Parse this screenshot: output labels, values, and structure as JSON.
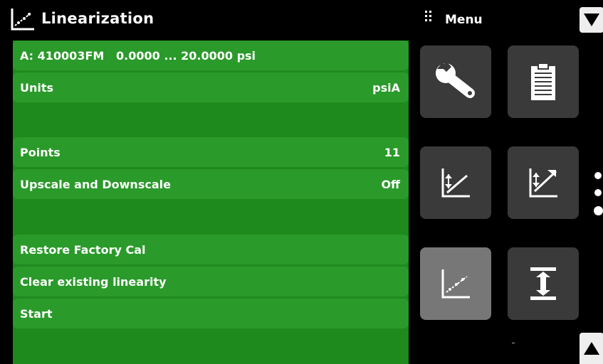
{
  "header": {
    "title": "Linearization",
    "icon": "linearization-chart-icon",
    "menu_label": "Menu",
    "menu_grip_icon": "grip-icon"
  },
  "sensor": {
    "header_text": "A: 410003FM   0.0000 ... 20.0000 psi"
  },
  "rows": {
    "units": {
      "label": "Units",
      "value": "psiA"
    },
    "points": {
      "label": "Points",
      "value": "11"
    },
    "updown": {
      "label": "Upscale and Downscale",
      "value": "Off"
    },
    "restore": {
      "label": "Restore Factory Cal"
    },
    "clear": {
      "label": "Clear existing linearity"
    },
    "start": {
      "label": "Start"
    }
  },
  "menu_tiles": [
    {
      "icon": "wrench-icon",
      "active": false
    },
    {
      "icon": "clipboard-icon",
      "active": false
    },
    {
      "icon": "zero-chart-icon",
      "active": false
    },
    {
      "icon": "span-chart-icon",
      "active": false
    },
    {
      "icon": "linearization-chart-icon",
      "active": true
    },
    {
      "icon": "height-adjust-icon",
      "active": false
    }
  ],
  "page_indicator": {
    "pages": 3
  },
  "colors": {
    "panel_green": "#1e8a1e",
    "row_green": "#2a9a2a",
    "tile_gray": "#3a3a3a",
    "tile_active": "#777777"
  }
}
